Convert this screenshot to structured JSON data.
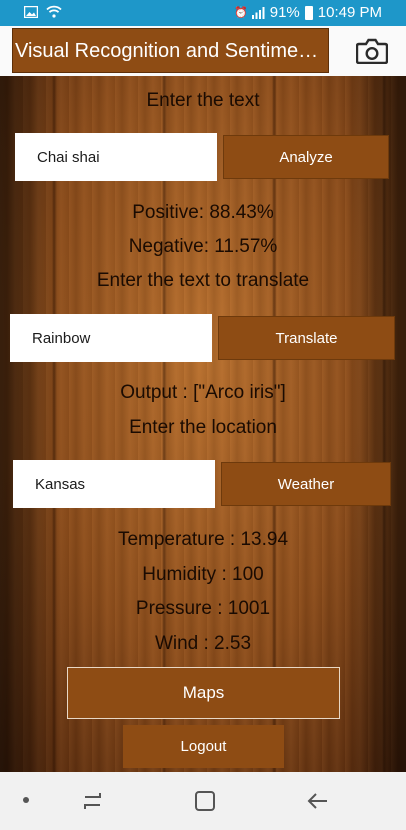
{
  "status_bar": {
    "battery": "91%",
    "time": "10:49 PM"
  },
  "app_bar": {
    "title": "Visual Recognition and Sentiment Analysis",
    "camera_icon": "camera-icon"
  },
  "sentiment": {
    "prompt": "Enter the text",
    "input_value": "Chai shai",
    "button_label": "Analyze",
    "positive": "Positive: 88.43%",
    "negative": "Negative: 11.57%"
  },
  "translate": {
    "prompt": "Enter the text to translate",
    "input_value": "Rainbow",
    "button_label": "Translate",
    "output": "Output : [\"Arco iris\"]"
  },
  "weather": {
    "prompt": "Enter the location",
    "input_value": "Kansas",
    "button_label": "Weather",
    "temperature": "Temperature : 13.94",
    "humidity": "Humidity : 100",
    "pressure": "Pressure : 1001",
    "wind": "Wind : 2.53"
  },
  "actions": {
    "maps_label": "Maps",
    "logout_label": "Logout"
  },
  "colors": {
    "status_bar": "#1e97c9",
    "button": "#8e4c14",
    "wood": "#8a4b1a"
  }
}
